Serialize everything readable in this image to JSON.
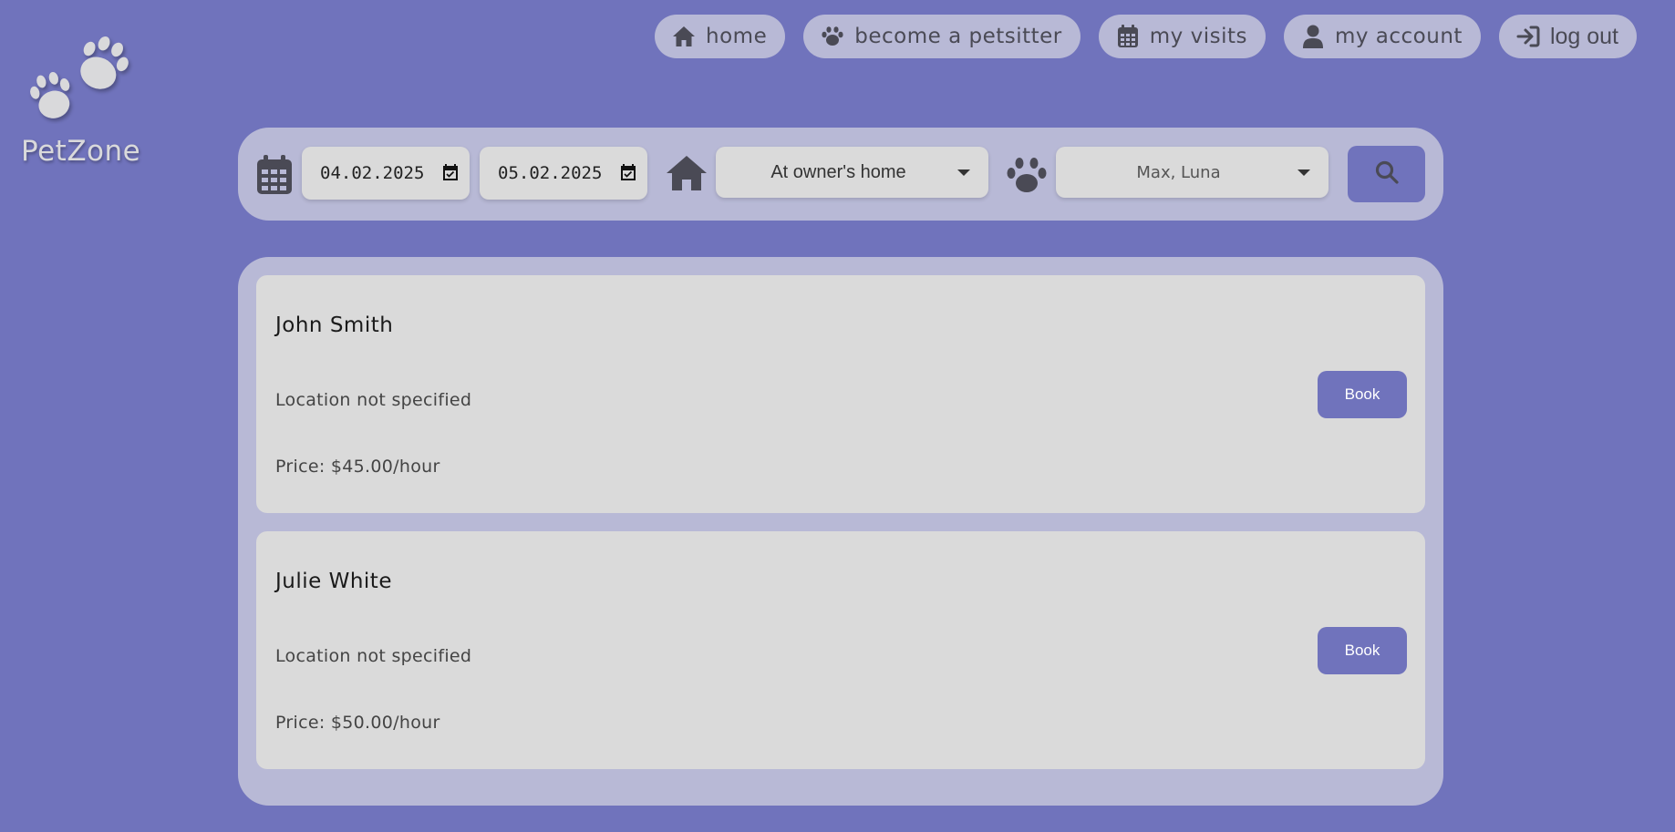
{
  "brand": {
    "name": "PetZone",
    "logo_icon": "paws-icon"
  },
  "nav": {
    "items": [
      {
        "label": "home",
        "icon": "home-icon"
      },
      {
        "label": "become a petsitter",
        "icon": "paw-icon"
      },
      {
        "label": "my visits",
        "icon": "calendar-icon"
      },
      {
        "label": "my account",
        "icon": "user-icon"
      },
      {
        "label": "log out",
        "icon": "sign-in-icon"
      }
    ]
  },
  "search": {
    "date_from": "04.02.2025",
    "date_to": "05.02.2025",
    "location_value": "At owner's home",
    "pets_value": "Max, Luna",
    "icons": {
      "calendar": "calendar-icon",
      "location": "home-icon",
      "pets": "paw-icon",
      "submit": "search-icon"
    }
  },
  "results": [
    {
      "name": "John Smith",
      "location": "Location not specified",
      "price": "Price: $45.00/hour",
      "action_label": "Book"
    },
    {
      "name": "Julie White",
      "location": "Location not specified",
      "price": "Price: $50.00/hour",
      "action_label": "Book"
    }
  ],
  "colors": {
    "background": "#7073bc",
    "panel": "#b8b9d6",
    "card": "#dadada",
    "accent": "#7073bc",
    "icon": "#4a4a55"
  }
}
